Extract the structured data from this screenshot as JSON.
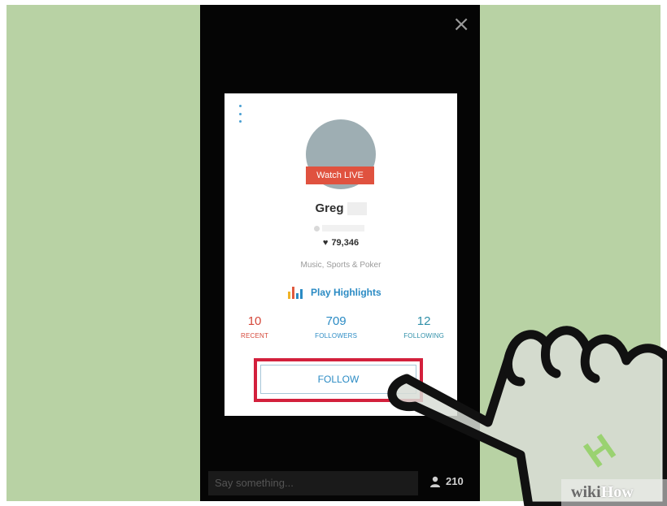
{
  "phone": {
    "close_glyph": "×",
    "composer_placeholder": "Say something...",
    "viewer_count": "210"
  },
  "profile": {
    "watch_live_label": "Watch LIVE",
    "name": "Greg",
    "likes": "79,346",
    "topics": "Music, Sports & Poker",
    "play_highlights_label": "Play Highlights",
    "stats": [
      {
        "value": "10",
        "label": "RECENT"
      },
      {
        "value": "709",
        "label": "FOLLOWERS"
      },
      {
        "value": "12",
        "label": "FOLLOWING"
      }
    ],
    "follow_label": "FOLLOW"
  },
  "watermark": {
    "wiki": "wiki",
    "how": "How"
  },
  "colors": {
    "background": "#b8d2a4",
    "live_red": "#e0523f",
    "accent_blue": "#2b8bc4",
    "highlight_red": "#d3203c"
  }
}
